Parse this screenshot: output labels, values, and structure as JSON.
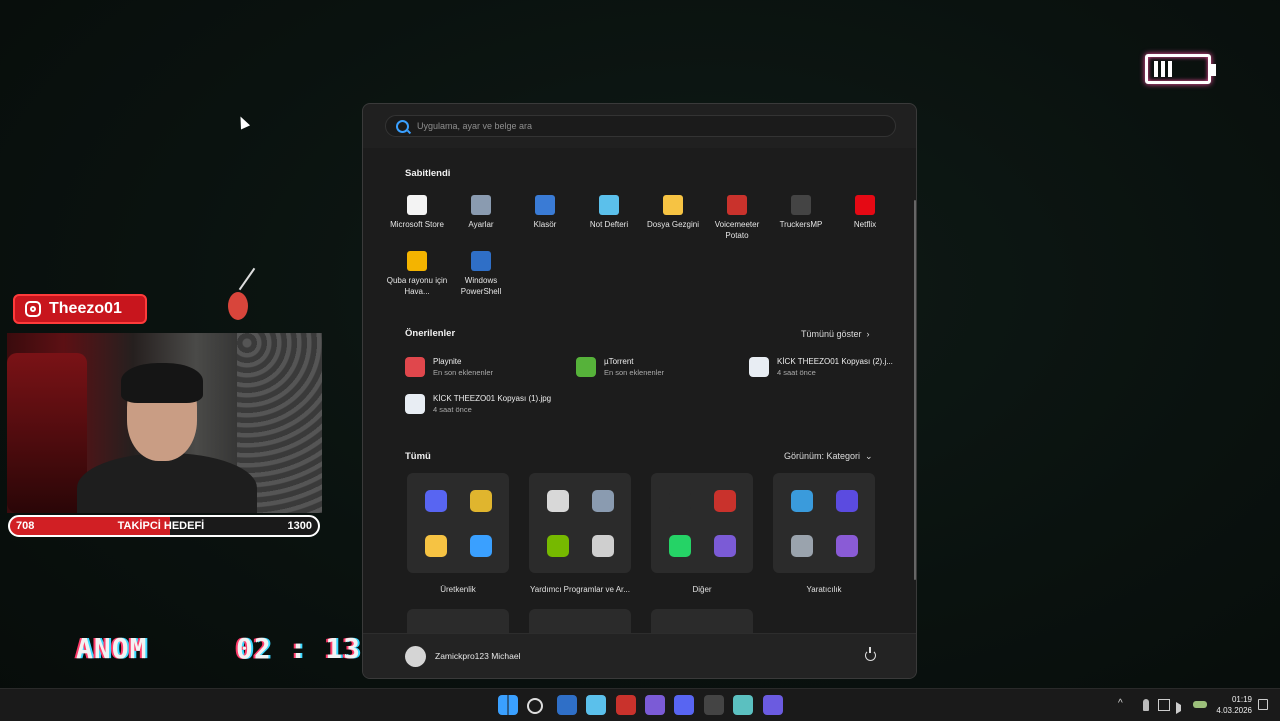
{
  "stream": {
    "instagram_handle": "Theezo01",
    "goal": {
      "current": "708",
      "label": "TAKİPCİ HEDEFİ",
      "target": "1300"
    },
    "tag": "ANOM",
    "timer": "02 : 13"
  },
  "start_menu": {
    "search_placeholder": "Uygulama, ayar ve belge ara",
    "pinned_title": "Sabitlendi",
    "pinned": [
      {
        "label": "Microsoft Store",
        "icon": "microsoft-store-icon",
        "color": "#f3f3f3"
      },
      {
        "label": "Ayarlar",
        "icon": "settings-gear-icon",
        "color": "#8a9bb0"
      },
      {
        "label": "Klasör",
        "icon": "folder-group-icon",
        "color": "#3a7bd5"
      },
      {
        "label": "Not Defteri",
        "icon": "notepad-icon",
        "color": "#5bc0eb"
      },
      {
        "label": "Dosya Gezgini",
        "icon": "file-explorer-icon",
        "color": "#f6c343"
      },
      {
        "label": "Voicemeeter Potato",
        "icon": "voicemeeter-icon",
        "color": "#c9322c"
      },
      {
        "label": "TruckersMP",
        "icon": "truckersmp-icon",
        "color": "#444444"
      },
      {
        "label": "Netflix",
        "icon": "netflix-icon",
        "color": "#e50914"
      },
      {
        "label": "Quba rayonu için Hava...",
        "icon": "weather-icon",
        "color": "#f4b400"
      },
      {
        "label": "Windows PowerShell",
        "icon": "powershell-icon",
        "color": "#2f6fc7"
      }
    ],
    "recommended_title": "Önerilenler",
    "show_all": "Tümünü göster",
    "recommended": [
      {
        "name": "Playnite",
        "sub": "En son eklenenler",
        "icon": "playnite-icon",
        "color": "#e0474c"
      },
      {
        "name": "µTorrent",
        "sub": "En son eklenenler",
        "icon": "utorrent-icon",
        "color": "#56b23a"
      },
      {
        "name": "KİCK  THEEZO01 Kopyası (2).j...",
        "sub": "4 saat önce",
        "icon": "image-file-icon",
        "color": "#e8edf3"
      },
      {
        "name": "KİCK  THEEZO01 Kopyası (1).jpg",
        "sub": "4 saat önce",
        "icon": "image-file-icon",
        "color": "#e8edf3"
      }
    ],
    "all_title": "Tümü",
    "view_label": "Görünüm: Kategori",
    "categories": [
      {
        "label": "Üretkenlik",
        "icons": [
          [
            "discord-icon",
            "#5865f2"
          ],
          [
            "chrome-icon",
            "#e0b52e"
          ],
          [
            "explorer-icon",
            "#f6c343"
          ],
          [
            "office-icon",
            "#3aa0ff"
          ]
        ]
      },
      {
        "label": "Yardımcı Programlar ve Ar...",
        "icons": [
          [
            "tools-icon",
            "#d8d8d8"
          ],
          [
            "settings-icon",
            "#8a9bb0"
          ],
          [
            "nvidia-icon",
            "#76b900"
          ],
          [
            "utility-icon",
            "#cfcfcf"
          ]
        ]
      },
      {
        "label": "Diğer",
        "icons": [
          [
            "obs-icon",
            "#2b2b2b"
          ],
          [
            "voicemeeter-icon",
            "#c9322c"
          ],
          [
            "whatsapp-icon",
            "#25d366"
          ],
          [
            "apps-icon",
            "#7b5bd6"
          ]
        ]
      },
      {
        "label": "Yaratıcılık",
        "icons": [
          [
            "photos-icon",
            "#3a9bdc"
          ],
          [
            "cortana-icon",
            "#5b4be0"
          ],
          [
            "camera-icon",
            "#9aa3ad"
          ],
          [
            "clipchamp-icon",
            "#8a5bd6"
          ]
        ]
      }
    ],
    "user": "Zamickpro123 Michael"
  },
  "taskbar": {
    "apps": [
      {
        "icon": "windows-start-icon",
        "color": "#3aa0ff"
      },
      {
        "icon": "search-icon",
        "color": "#dddddd"
      },
      {
        "icon": "powershell-icon",
        "color": "#2f6fc7"
      },
      {
        "icon": "notepad-icon",
        "color": "#5bc0eb"
      },
      {
        "icon": "voicemeeter-icon",
        "color": "#c9322c"
      },
      {
        "icon": "apps-grid-icon",
        "color": "#7b5bd6"
      },
      {
        "icon": "discord-icon",
        "color": "#5865f2"
      },
      {
        "icon": "obs-icon",
        "color": "#444444"
      },
      {
        "icon": "photos-icon",
        "color": "#5bc0c0"
      },
      {
        "icon": "cortana-icon",
        "color": "#6b5be0"
      }
    ],
    "time": "01:19",
    "date": "4.03.2026"
  }
}
